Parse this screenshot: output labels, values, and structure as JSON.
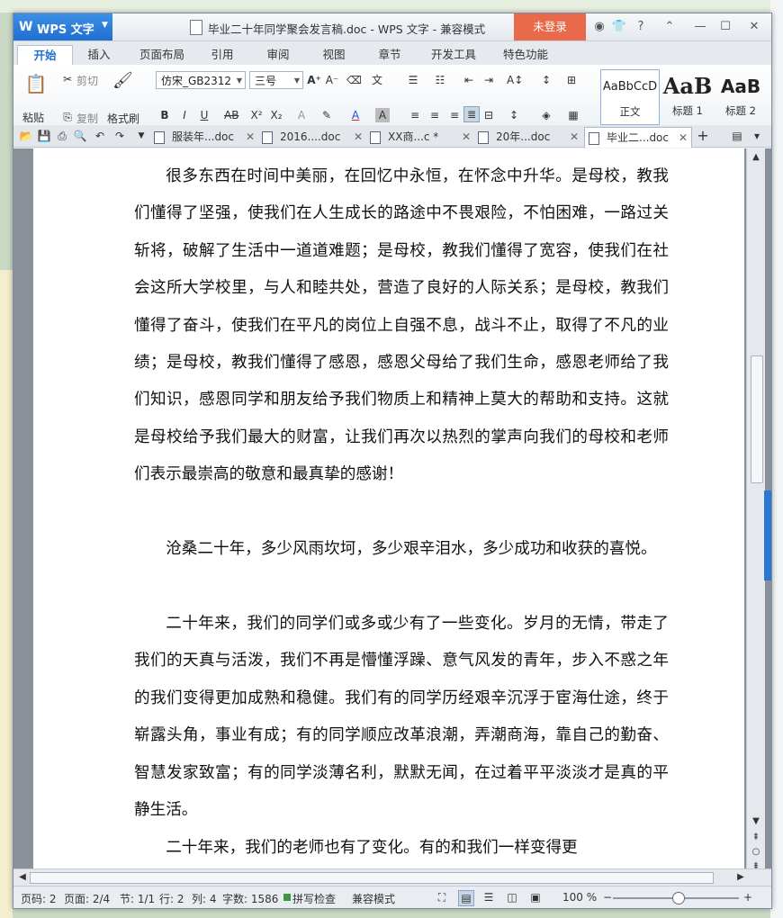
{
  "window": {
    "app_menu": "WPS 文字",
    "title": "毕业二十年同学聚会发言稿.doc - WPS 文字 - 兼容模式",
    "login": "未登录"
  },
  "ribbon_tabs": [
    "开始",
    "插入",
    "页面布局",
    "引用",
    "审阅",
    "视图",
    "章节",
    "开发工具",
    "特色功能"
  ],
  "ribbon": {
    "paste": "粘贴",
    "cut": "剪切",
    "copy": "复制",
    "format_painter": "格式刷",
    "font_name": "仿宋_GB2312",
    "font_size": "三号",
    "styles": [
      {
        "preview": "AaBbCcD",
        "label": "正文"
      },
      {
        "preview": "AaB",
        "label": "标题 1"
      },
      {
        "preview": "AaB",
        "label": "标题 2"
      }
    ]
  },
  "doc_tabs": [
    "服装年...doc",
    "2016....doc",
    "XX商...c *",
    "20年...doc",
    "毕业二...doc"
  ],
  "document": {
    "paragraphs": [
      "很多东西在时间中美丽，在回忆中永恒，在怀念中升华。是母校，教我们懂得了坚强，使我们在人生成长的路途中不畏艰险，不怕困难，一路过关斩将，破解了生活中一道道难题；是母校，教我们懂得了宽容，使我们在社会这所大学校里，与人和睦共处，营造了良好的人际关系；是母校，教我们懂得了奋斗，使我们在平凡的岗位上自强不息，战斗不止，取得了不凡的业绩；是母校，教我们懂得了感恩，感恩父母给了我们生命，感恩老师给了我们知识，感恩同学和朋友给予我们物质上和精神上莫大的帮助和支持。这就是母校给予我们最大的财富，让我们再次以热烈的掌声向我们的母校和老师们表示最崇高的敬意和最真挚的感谢！",
      "沧桑二十年，多少风雨坎坷，多少艰辛泪水，多少成功和收获的喜悦。",
      "二十年来，我们的同学们或多或少有了一些变化。岁月的无情，带走了我们的天真与活泼，我们不再是懵懂浮躁、意气风发的青年，步入不惑之年的我们变得更加成熟和稳健。我们有的同学历经艰辛沉浮于宦海仕途，终于崭露头角，事业有成；有的同学顺应改革浪潮，弄潮商海，靠自己的勤奋、智慧发家致富；有的同学淡薄名利，默默无闻，在过着平平淡淡才是真的平静生活。",
      "二十年来，我们的老师也有了变化。有的和我们一样变得更"
    ]
  },
  "status": {
    "page_code": "页码: 2",
    "pages": "页面: 2/4",
    "section": "节: 1/1",
    "line": "行: 2",
    "column": "列: 4",
    "word_count": "字数: 1586",
    "spell_check": "拼写检查",
    "compat_mode": "兼容模式",
    "zoom": "100 %"
  },
  "colors": {
    "accent": "#1e6fd0",
    "login": "#e86a4a"
  }
}
